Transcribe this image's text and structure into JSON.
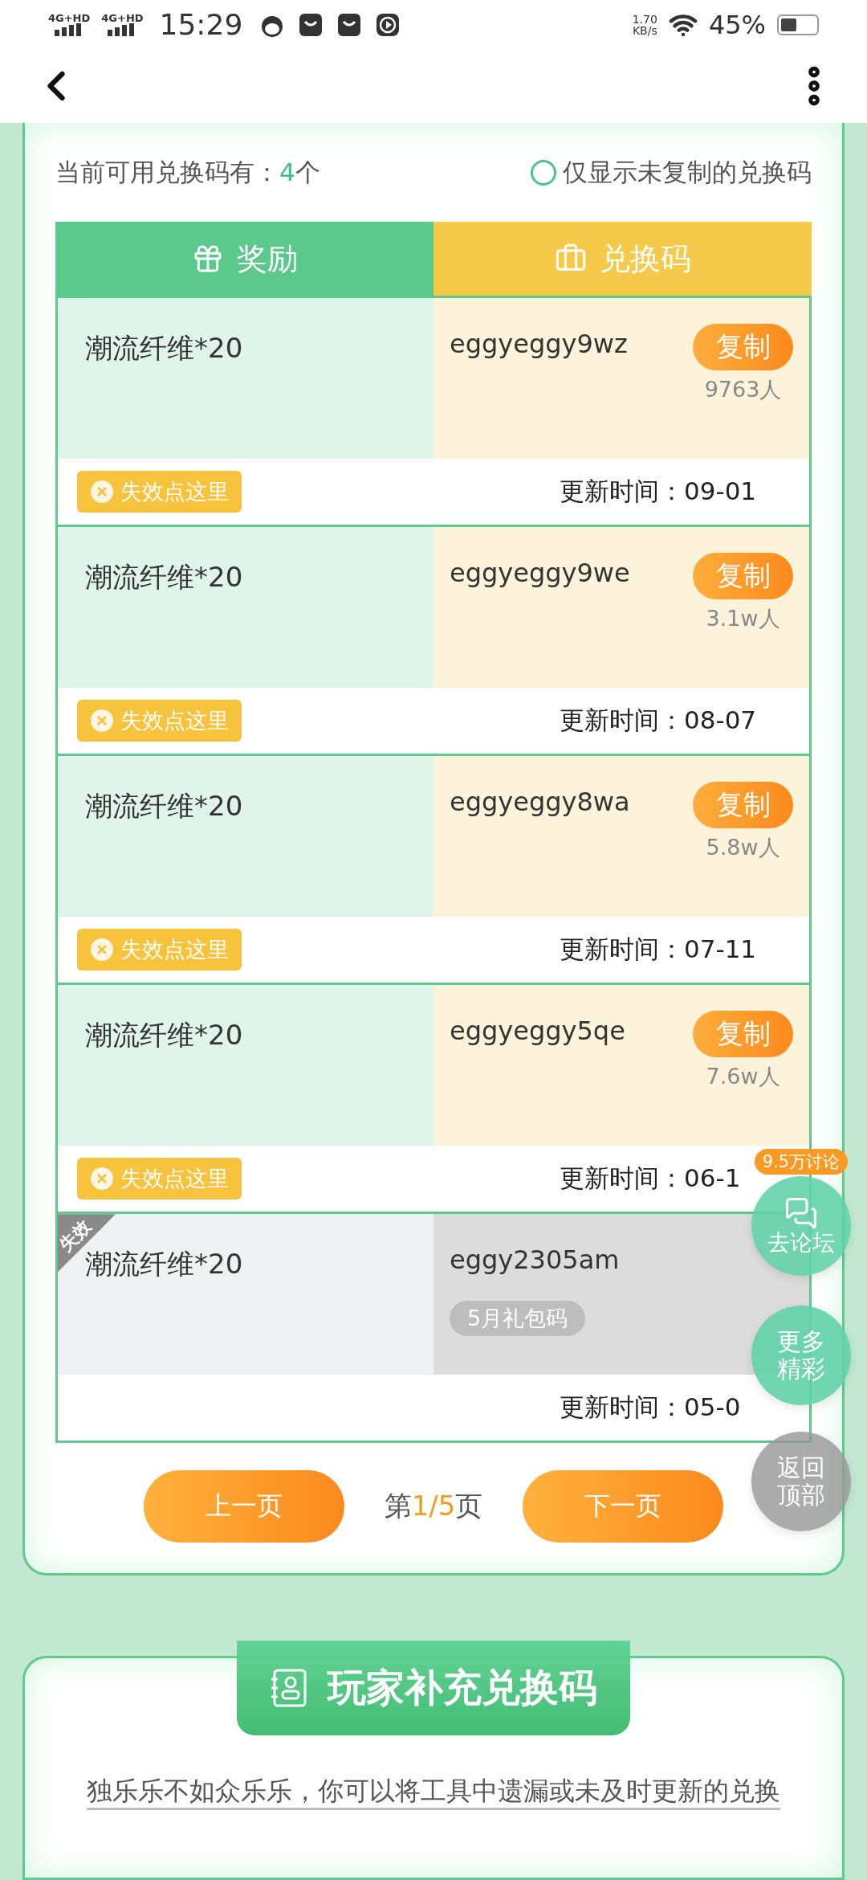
{
  "status_bar": {
    "signals": [
      "4G+HD",
      "4G+HD"
    ],
    "time": "15:29",
    "speed_value": "1.70",
    "speed_unit": "KB/s",
    "battery": "45%"
  },
  "filter": {
    "label": "当前可用兑换码有：",
    "count": "4",
    "unit": "个",
    "toggle_label": "仅显示未复制的兑换码",
    "toggle_checked": false
  },
  "table": {
    "columns": [
      "奖励",
      "兑换码"
    ],
    "rows": [
      {
        "kind": "active",
        "reward": "潮流纤维*20",
        "code": "eggyeggy9wz",
        "action": "复制",
        "users": "9763人",
        "report": "失效点这里",
        "updated": "更新时间：09-01"
      },
      {
        "kind": "active",
        "reward": "潮流纤维*20",
        "code": "eggyeggy9we",
        "action": "复制",
        "users": "3.1w人",
        "report": "失效点这里",
        "updated": "更新时间：08-07"
      },
      {
        "kind": "active",
        "reward": "潮流纤维*20",
        "code": "eggyeggy8wa",
        "action": "复制",
        "users": "5.8w人",
        "report": "失效点这里",
        "updated": "更新时间：07-11"
      },
      {
        "kind": "active",
        "reward": "潮流纤维*20",
        "code": "eggyeggy5qe",
        "action": "复制",
        "users": "7.6w人",
        "report": "失效点这里",
        "updated": "更新时间：06-1"
      },
      {
        "kind": "expired",
        "ribbon": "失效",
        "reward": "潮流纤维*20",
        "code": "eggy2305am",
        "tag": "5月礼包码",
        "updated": "更新时间：05-0"
      }
    ]
  },
  "pagination": {
    "prev": "上一页",
    "prefix": "第",
    "page": "1/5",
    "suffix": "页",
    "next": "下一页"
  },
  "floating": {
    "forum_badge": "9.5万讨论",
    "forum": "去论坛",
    "more": "更多精彩",
    "top": "返回顶部"
  },
  "supplement": {
    "title": "玩家补充兑换码",
    "text": "独乐乐不如众乐乐，你可以将工具中遗漏或未及时更新的兑换"
  }
}
